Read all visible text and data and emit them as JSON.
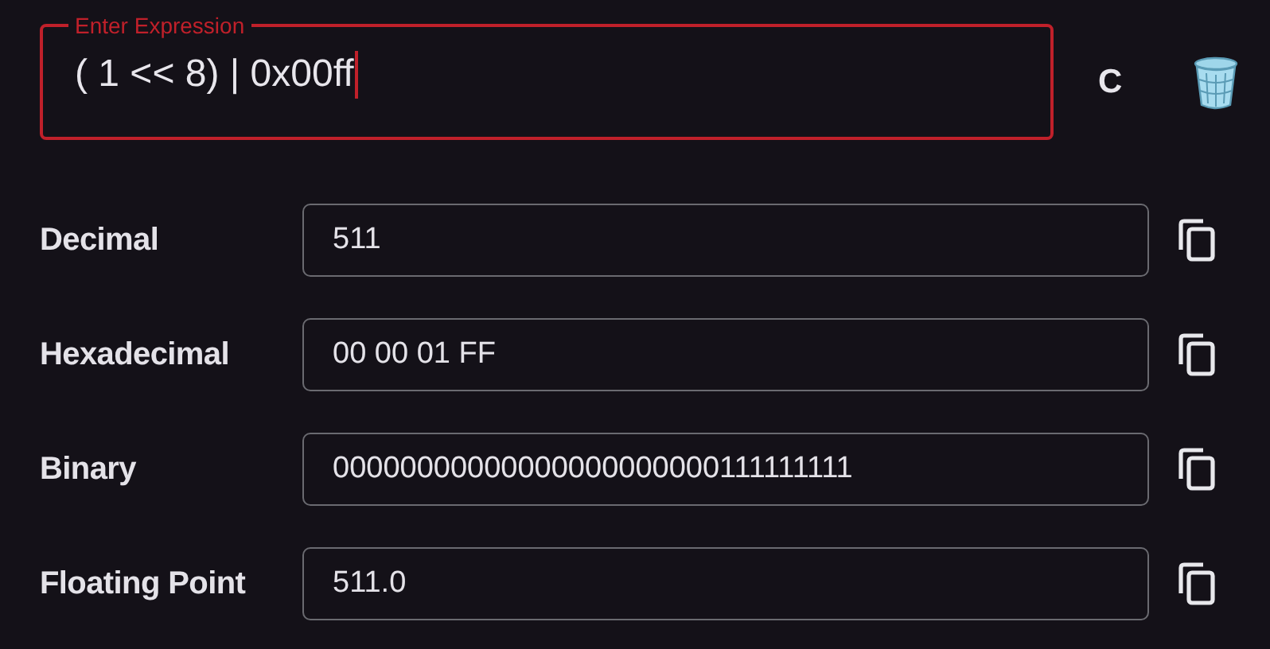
{
  "expression": {
    "label": "Enter Expression",
    "value": "( 1 << 8) | 0x00ff",
    "focused": true
  },
  "clear_button": "C",
  "results": [
    {
      "label": "Decimal",
      "value": "511"
    },
    {
      "label": "Hexadecimal",
      "value": "00 00 01 FF"
    },
    {
      "label": "Binary",
      "value": "00000000000000000000000111111111"
    },
    {
      "label": "Floating Point",
      "value": "511.0"
    }
  ]
}
